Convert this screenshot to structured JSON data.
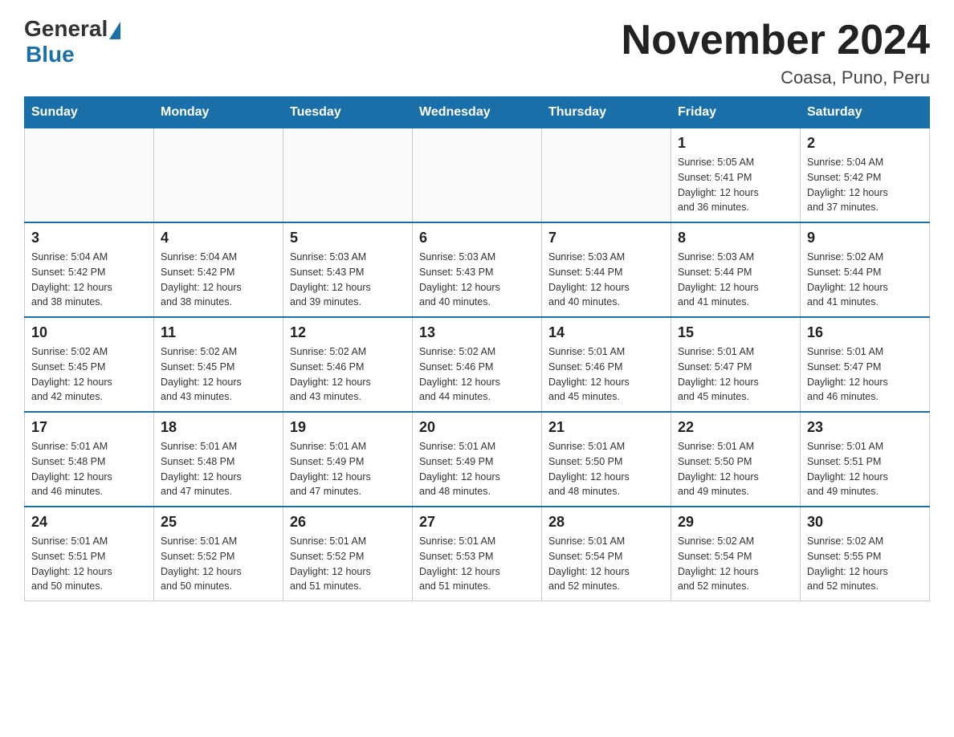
{
  "header": {
    "logo_general": "General",
    "logo_blue": "Blue",
    "month_title": "November 2024",
    "location": "Coasa, Puno, Peru"
  },
  "weekdays": [
    "Sunday",
    "Monday",
    "Tuesday",
    "Wednesday",
    "Thursday",
    "Friday",
    "Saturday"
  ],
  "weeks": [
    [
      {
        "day": "",
        "info": ""
      },
      {
        "day": "",
        "info": ""
      },
      {
        "day": "",
        "info": ""
      },
      {
        "day": "",
        "info": ""
      },
      {
        "day": "",
        "info": ""
      },
      {
        "day": "1",
        "info": "Sunrise: 5:05 AM\nSunset: 5:41 PM\nDaylight: 12 hours\nand 36 minutes."
      },
      {
        "day": "2",
        "info": "Sunrise: 5:04 AM\nSunset: 5:42 PM\nDaylight: 12 hours\nand 37 minutes."
      }
    ],
    [
      {
        "day": "3",
        "info": "Sunrise: 5:04 AM\nSunset: 5:42 PM\nDaylight: 12 hours\nand 38 minutes."
      },
      {
        "day": "4",
        "info": "Sunrise: 5:04 AM\nSunset: 5:42 PM\nDaylight: 12 hours\nand 38 minutes."
      },
      {
        "day": "5",
        "info": "Sunrise: 5:03 AM\nSunset: 5:43 PM\nDaylight: 12 hours\nand 39 minutes."
      },
      {
        "day": "6",
        "info": "Sunrise: 5:03 AM\nSunset: 5:43 PM\nDaylight: 12 hours\nand 40 minutes."
      },
      {
        "day": "7",
        "info": "Sunrise: 5:03 AM\nSunset: 5:44 PM\nDaylight: 12 hours\nand 40 minutes."
      },
      {
        "day": "8",
        "info": "Sunrise: 5:03 AM\nSunset: 5:44 PM\nDaylight: 12 hours\nand 41 minutes."
      },
      {
        "day": "9",
        "info": "Sunrise: 5:02 AM\nSunset: 5:44 PM\nDaylight: 12 hours\nand 41 minutes."
      }
    ],
    [
      {
        "day": "10",
        "info": "Sunrise: 5:02 AM\nSunset: 5:45 PM\nDaylight: 12 hours\nand 42 minutes."
      },
      {
        "day": "11",
        "info": "Sunrise: 5:02 AM\nSunset: 5:45 PM\nDaylight: 12 hours\nand 43 minutes."
      },
      {
        "day": "12",
        "info": "Sunrise: 5:02 AM\nSunset: 5:46 PM\nDaylight: 12 hours\nand 43 minutes."
      },
      {
        "day": "13",
        "info": "Sunrise: 5:02 AM\nSunset: 5:46 PM\nDaylight: 12 hours\nand 44 minutes."
      },
      {
        "day": "14",
        "info": "Sunrise: 5:01 AM\nSunset: 5:46 PM\nDaylight: 12 hours\nand 45 minutes."
      },
      {
        "day": "15",
        "info": "Sunrise: 5:01 AM\nSunset: 5:47 PM\nDaylight: 12 hours\nand 45 minutes."
      },
      {
        "day": "16",
        "info": "Sunrise: 5:01 AM\nSunset: 5:47 PM\nDaylight: 12 hours\nand 46 minutes."
      }
    ],
    [
      {
        "day": "17",
        "info": "Sunrise: 5:01 AM\nSunset: 5:48 PM\nDaylight: 12 hours\nand 46 minutes."
      },
      {
        "day": "18",
        "info": "Sunrise: 5:01 AM\nSunset: 5:48 PM\nDaylight: 12 hours\nand 47 minutes."
      },
      {
        "day": "19",
        "info": "Sunrise: 5:01 AM\nSunset: 5:49 PM\nDaylight: 12 hours\nand 47 minutes."
      },
      {
        "day": "20",
        "info": "Sunrise: 5:01 AM\nSunset: 5:49 PM\nDaylight: 12 hours\nand 48 minutes."
      },
      {
        "day": "21",
        "info": "Sunrise: 5:01 AM\nSunset: 5:50 PM\nDaylight: 12 hours\nand 48 minutes."
      },
      {
        "day": "22",
        "info": "Sunrise: 5:01 AM\nSunset: 5:50 PM\nDaylight: 12 hours\nand 49 minutes."
      },
      {
        "day": "23",
        "info": "Sunrise: 5:01 AM\nSunset: 5:51 PM\nDaylight: 12 hours\nand 49 minutes."
      }
    ],
    [
      {
        "day": "24",
        "info": "Sunrise: 5:01 AM\nSunset: 5:51 PM\nDaylight: 12 hours\nand 50 minutes."
      },
      {
        "day": "25",
        "info": "Sunrise: 5:01 AM\nSunset: 5:52 PM\nDaylight: 12 hours\nand 50 minutes."
      },
      {
        "day": "26",
        "info": "Sunrise: 5:01 AM\nSunset: 5:52 PM\nDaylight: 12 hours\nand 51 minutes."
      },
      {
        "day": "27",
        "info": "Sunrise: 5:01 AM\nSunset: 5:53 PM\nDaylight: 12 hours\nand 51 minutes."
      },
      {
        "day": "28",
        "info": "Sunrise: 5:01 AM\nSunset: 5:54 PM\nDaylight: 12 hours\nand 52 minutes."
      },
      {
        "day": "29",
        "info": "Sunrise: 5:02 AM\nSunset: 5:54 PM\nDaylight: 12 hours\nand 52 minutes."
      },
      {
        "day": "30",
        "info": "Sunrise: 5:02 AM\nSunset: 5:55 PM\nDaylight: 12 hours\nand 52 minutes."
      }
    ]
  ]
}
